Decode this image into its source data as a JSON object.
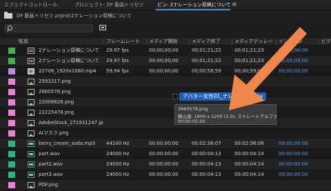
{
  "tabs": [
    {
      "label": "エフェクトコントロール",
      "active": false
    },
    {
      "label": "プロジェクト: DF 動画トリセツ",
      "active": false
    },
    {
      "label": "ビン: 2ナレーション原稿について",
      "active": true
    }
  ],
  "menu_icon": "≡",
  "path": "DF 動画トリセツ.prproj\\2ナレーション原稿について",
  "search": {
    "placeholder": ""
  },
  "columns": [
    "名前",
    "フレームレート",
    "メディア開始",
    "メディア終了",
    "メディアデュレー",
    "インポイン",
    "ビデ"
  ],
  "rows": [
    {
      "color": "#3fb34f",
      "icon": "sequence",
      "name": "2ナレーション原稿について",
      "fps": "29.97 fps",
      "start": "00;00;00;00",
      "end": "00;01;21;22",
      "dur": "00;01;21;23",
      "in": "00;00;00;00"
    },
    {
      "color": "#3fb34f",
      "icon": "sequence",
      "name": "2ナレーション原稿について",
      "fps": "29.97 fps",
      "start": "00;00;00;00",
      "end": "00;01;21;22",
      "dur": "00;01;21;23",
      "in": "00;00;00;00"
    },
    {
      "color": "#b58ee6",
      "icon": "video",
      "name": "22708_1920x1080.mp4",
      "fps": "59.94 fps",
      "start": "00;00;00;00",
      "end": "00;00;58;59",
      "dur": "00;00;59;00",
      "in": "00;00;00;00"
    },
    {
      "color": "#ee82d7",
      "icon": "image",
      "name": "2593317.png",
      "fps": "",
      "start": "",
      "end": "",
      "dur": "",
      "in": ""
    },
    {
      "color": "#ee82d7",
      "icon": "image",
      "name": "2660578.png",
      "fps": "",
      "start": "",
      "end": "",
      "dur": "",
      "in": ""
    },
    {
      "color": "#ee82d7",
      "icon": "image",
      "name": "22006628.png",
      "fps": "",
      "start": "",
      "end": "",
      "dur": "",
      "in": ""
    },
    {
      "color": "#ee82d7",
      "icon": "image",
      "name": "22225478.png",
      "fps": "",
      "start": "",
      "end": "",
      "dur": "",
      "in": ""
    },
    {
      "color": "#ee82d7",
      "icon": "image",
      "name": "AdobeStock_271931247.jpeg",
      "fps": "",
      "start": "",
      "end": "",
      "dur": "",
      "in": ""
    },
    {
      "color": "#ee82d7",
      "icon": "image",
      "name": "AIマスク.png",
      "fps": "",
      "start": "",
      "end": "",
      "dur": "",
      "in": ""
    },
    {
      "color": "#27b58a",
      "icon": "audio",
      "name": "berry_cream_soda.mp3",
      "fps": "44100 Hz",
      "start": "00:00:00:00",
      "end": "00:02:36:07",
      "dur": "00:02:36:08",
      "in": "00:00:00:00"
    },
    {
      "color": "#27b58a",
      "icon": "audio",
      "name": "part.wav",
      "fps": "24000 Hz",
      "start": "00:00:00:00",
      "end": "00:00:04:13",
      "dur": "00:00:04:14",
      "in": "00:00:00:00"
    },
    {
      "color": "#27b58a",
      "icon": "audio",
      "name": "part2.wav",
      "fps": "24000 Hz",
      "start": "00:00:00:00",
      "end": "00:00:04:13",
      "dur": "00:00:04:14",
      "in": "00:00:00:00"
    },
    {
      "color": "#27b58a",
      "icon": "audio",
      "name": "part3.wav",
      "fps": "24000 Hz",
      "start": "00:00:00:00",
      "end": "00:00:04:13",
      "dur": "00:00:04:14",
      "in": "00:00:00:00"
    },
    {
      "color": "#ee82d7",
      "icon": "image",
      "name": "PDF.png",
      "fps": "",
      "start": "",
      "end": "",
      "dur": "",
      "in": ""
    }
  ],
  "drag_label": "アバター女性01_ナレ女性01.mov",
  "tooltip": {
    "line1": "2660578.png",
    "line2": "静止画, 1600 x 1200 (1.0), ストレートアルファ",
    "line3": "00:00:05:00"
  },
  "colors": {
    "accent": "#4d8fdc",
    "arrow": "#f0874a",
    "drag_label_bg": "#1f5fbf"
  }
}
